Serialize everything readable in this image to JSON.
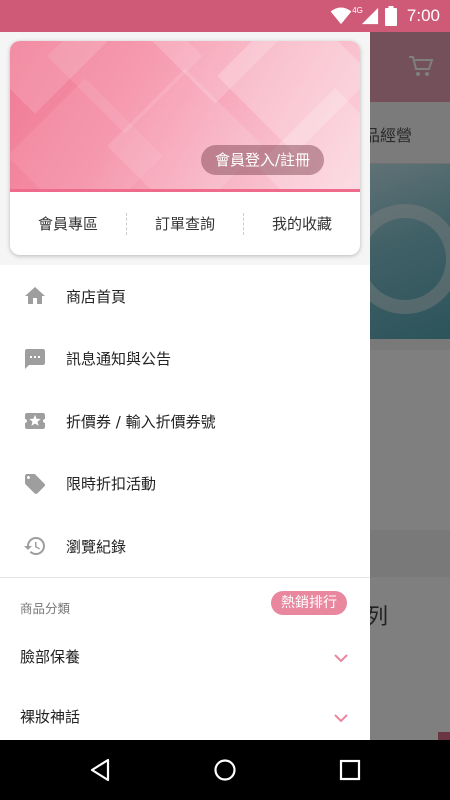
{
  "status_bar": {
    "time": "7:00",
    "network": "4G",
    "icons": [
      "wifi-icon",
      "signal-icon",
      "battery-icon"
    ]
  },
  "background_app": {
    "tab_fragment": "品經營",
    "section_fragment": "列",
    "cart_icon": "cart-icon"
  },
  "drawer": {
    "login_button": "會員登入/註冊",
    "quick_links": [
      "會員專區",
      "訂單查詢",
      "我的收藏"
    ],
    "menu_items": [
      {
        "label": "商店首頁",
        "icon": "home-icon"
      },
      {
        "label": "訊息通知與公告",
        "icon": "message-icon"
      },
      {
        "label": "折價券 / 輸入折價券號",
        "icon": "coupon-icon"
      },
      {
        "label": "限時折扣活動",
        "icon": "tag-icon"
      },
      {
        "label": "瀏覽紀錄",
        "icon": "history-icon"
      }
    ],
    "category_section": {
      "title": "商品分類",
      "hot_badge": "熱銷排行",
      "categories": [
        {
          "label": "臉部保養",
          "icon": "chevron-down-icon"
        },
        {
          "label": "裸妝神話",
          "icon": "chevron-down-icon"
        }
      ]
    }
  },
  "nav_bar": {
    "buttons": [
      "back-icon",
      "home-circle-icon",
      "recents-icon"
    ]
  },
  "colors": {
    "status_bar": "#cf5a78",
    "accent": "#e8879d",
    "chevron": "#e8879d",
    "icon_gray": "#9e9e9e"
  }
}
